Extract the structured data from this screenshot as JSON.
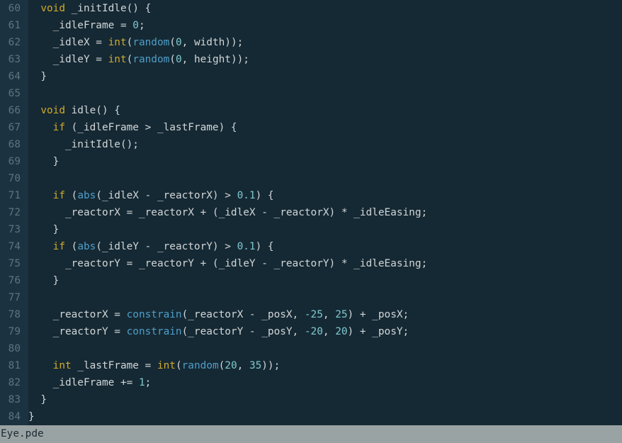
{
  "editor": {
    "lines": [
      {
        "n": "60",
        "tokens": [
          {
            "t": "  "
          },
          {
            "t": "void",
            "k": "kw"
          },
          {
            "t": " _initIdle() {"
          }
        ]
      },
      {
        "n": "61",
        "tokens": [
          {
            "t": "    _idleFrame = "
          },
          {
            "t": "0",
            "k": "num"
          },
          {
            "t": ";"
          }
        ]
      },
      {
        "n": "62",
        "tokens": [
          {
            "t": "    _idleX = "
          },
          {
            "t": "int",
            "k": "kw"
          },
          {
            "t": "("
          },
          {
            "t": "random",
            "k": "fn"
          },
          {
            "t": "("
          },
          {
            "t": "0",
            "k": "num"
          },
          {
            "t": ", width));"
          }
        ]
      },
      {
        "n": "63",
        "tokens": [
          {
            "t": "    _idleY = "
          },
          {
            "t": "int",
            "k": "kw"
          },
          {
            "t": "("
          },
          {
            "t": "random",
            "k": "fn"
          },
          {
            "t": "("
          },
          {
            "t": "0",
            "k": "num"
          },
          {
            "t": ", height));"
          }
        ]
      },
      {
        "n": "64",
        "tokens": [
          {
            "t": "  }"
          }
        ]
      },
      {
        "n": "65",
        "tokens": []
      },
      {
        "n": "66",
        "tokens": [
          {
            "t": "  "
          },
          {
            "t": "void",
            "k": "kw"
          },
          {
            "t": " idle() {"
          }
        ]
      },
      {
        "n": "67",
        "tokens": [
          {
            "t": "    "
          },
          {
            "t": "if",
            "k": "kw"
          },
          {
            "t": " (_idleFrame > _lastFrame) {"
          }
        ]
      },
      {
        "n": "68",
        "tokens": [
          {
            "t": "      _initIdle();"
          }
        ]
      },
      {
        "n": "69",
        "tokens": [
          {
            "t": "    }"
          }
        ]
      },
      {
        "n": "70",
        "tokens": []
      },
      {
        "n": "71",
        "tokens": [
          {
            "t": "    "
          },
          {
            "t": "if",
            "k": "kw"
          },
          {
            "t": " ("
          },
          {
            "t": "abs",
            "k": "fn"
          },
          {
            "t": "(_idleX - _reactorX) > "
          },
          {
            "t": "0.1",
            "k": "num"
          },
          {
            "t": ") {"
          }
        ]
      },
      {
        "n": "72",
        "tokens": [
          {
            "t": "      _reactorX = _reactorX + (_idleX - _reactorX) * _idleEasing;"
          }
        ]
      },
      {
        "n": "73",
        "tokens": [
          {
            "t": "    }"
          }
        ]
      },
      {
        "n": "74",
        "tokens": [
          {
            "t": "    "
          },
          {
            "t": "if",
            "k": "kw"
          },
          {
            "t": " ("
          },
          {
            "t": "abs",
            "k": "fn"
          },
          {
            "t": "(_idleY - _reactorY) > "
          },
          {
            "t": "0.1",
            "k": "num"
          },
          {
            "t": ") {"
          }
        ]
      },
      {
        "n": "75",
        "tokens": [
          {
            "t": "      _reactorY = _reactorY + (_idleY - _reactorY) * _idleEasing;"
          }
        ]
      },
      {
        "n": "76",
        "tokens": [
          {
            "t": "    }"
          }
        ]
      },
      {
        "n": "77",
        "tokens": []
      },
      {
        "n": "78",
        "tokens": [
          {
            "t": "    _reactorX = "
          },
          {
            "t": "constrain",
            "k": "fn"
          },
          {
            "t": "(_reactorX - _posX, "
          },
          {
            "t": "-25",
            "k": "num"
          },
          {
            "t": ", "
          },
          {
            "t": "25",
            "k": "num"
          },
          {
            "t": ") + _posX;"
          }
        ]
      },
      {
        "n": "79",
        "tokens": [
          {
            "t": "    _reactorY = "
          },
          {
            "t": "constrain",
            "k": "fn"
          },
          {
            "t": "(_reactorY - _posY, "
          },
          {
            "t": "-20",
            "k": "num"
          },
          {
            "t": ", "
          },
          {
            "t": "20",
            "k": "num"
          },
          {
            "t": ") + _posY;"
          }
        ]
      },
      {
        "n": "80",
        "tokens": []
      },
      {
        "n": "81",
        "tokens": [
          {
            "t": "    "
          },
          {
            "t": "int",
            "k": "kw"
          },
          {
            "t": " _lastFrame = "
          },
          {
            "t": "int",
            "k": "kw"
          },
          {
            "t": "("
          },
          {
            "t": "random",
            "k": "fn"
          },
          {
            "t": "("
          },
          {
            "t": "20",
            "k": "num"
          },
          {
            "t": ", "
          },
          {
            "t": "35",
            "k": "num"
          },
          {
            "t": "));"
          }
        ]
      },
      {
        "n": "82",
        "tokens": [
          {
            "t": "    _idleFrame += "
          },
          {
            "t": "1",
            "k": "num"
          },
          {
            "t": ";"
          }
        ]
      },
      {
        "n": "83",
        "tokens": [
          {
            "t": "  }"
          }
        ]
      },
      {
        "n": "84",
        "tokens": [
          {
            "t": "}"
          }
        ]
      }
    ]
  },
  "statusbar": {
    "filename": "Eye.pde"
  },
  "colors": {
    "background": "#152934",
    "gutter": "#1b3340",
    "line_number": "#5d7480",
    "text": "#d2d6d7",
    "keyword": "#d0a92c",
    "function": "#4f9ec9",
    "number": "#80c9cf",
    "statusbar": "#9aa3a4"
  }
}
